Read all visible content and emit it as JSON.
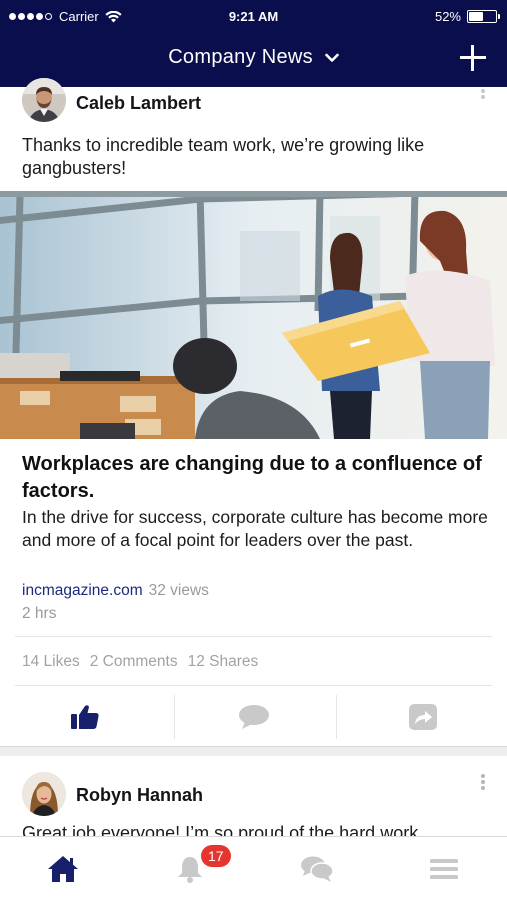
{
  "status_bar": {
    "carrier": "Carrier",
    "time": "9:21 AM",
    "battery": "52%",
    "battery_level": 0.52
  },
  "nav": {
    "title": "Company News",
    "title_icon": "chevron-down-icon",
    "action_icon": "plus-icon"
  },
  "post1": {
    "author": "Caleb Lambert",
    "text": "Thanks to incredible team work, we’re growing like gangbusters!",
    "article_title": "Workplaces are changing due to a confluence of factors.",
    "article_description": "In the drive for success, corporate culture has become more and more of a focal point for leaders over the past.",
    "source": "incmagazine.com",
    "views": "32 views",
    "time_ago": "2 hrs",
    "likes": "14 Likes",
    "comments": "2 Comments",
    "shares": "12 Shares",
    "actions": [
      "like-icon",
      "comment-icon",
      "share-icon"
    ]
  },
  "post2": {
    "author": "Robyn Hannah",
    "text": "Great job everyone! I’m so proud of the hard work"
  },
  "tabbar": {
    "tabs": [
      "home-icon",
      "bell-icon",
      "chat-icon",
      "menu-icon"
    ],
    "notification_count": "17"
  },
  "colors": {
    "header_bg": "#0a0e4c",
    "accent": "#1d2a7a",
    "badge": "#e5352e",
    "muted_icon": "#c9c9c9"
  }
}
